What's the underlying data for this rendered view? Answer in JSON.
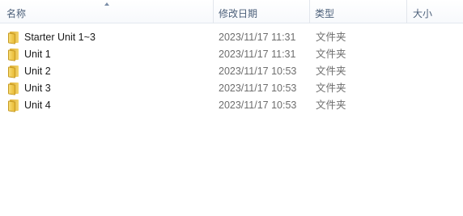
{
  "columns": {
    "name": "名称",
    "date_modified": "修改日期",
    "type": "类型",
    "size": "大小"
  },
  "items": [
    {
      "name": "Starter Unit 1~3",
      "date_modified": "2023/11/17 11:31",
      "type": "文件夹",
      "icon": "folder-icon"
    },
    {
      "name": "Unit 1",
      "date_modified": "2023/11/17 11:31",
      "type": "文件夹",
      "icon": "folder-icon"
    },
    {
      "name": "Unit 2",
      "date_modified": "2023/11/17 10:53",
      "type": "文件夹",
      "icon": "folder-icon"
    },
    {
      "name": "Unit 3",
      "date_modified": "2023/11/17 10:53",
      "type": "文件夹",
      "icon": "folder-icon"
    },
    {
      "name": "Unit 4",
      "date_modified": "2023/11/17 10:53",
      "type": "文件夹",
      "icon": "folder-icon"
    }
  ],
  "colors": {
    "header_text": "#4c607a",
    "folder": "#f0c94f",
    "secondary_text": "#6d6d6d"
  }
}
